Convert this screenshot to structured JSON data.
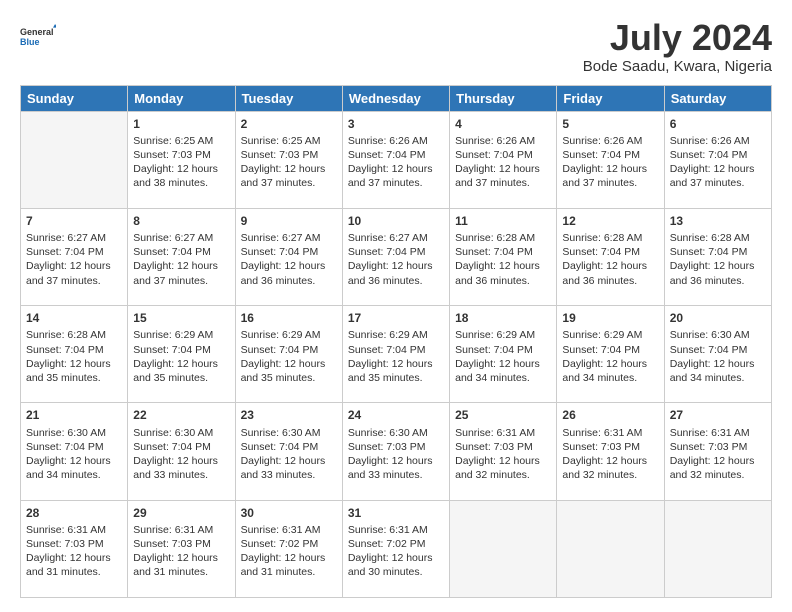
{
  "logo": {
    "line1": "General",
    "line2": "Blue"
  },
  "title": "July 2024",
  "subtitle": "Bode Saadu, Kwara, Nigeria",
  "days_of_week": [
    "Sunday",
    "Monday",
    "Tuesday",
    "Wednesday",
    "Thursday",
    "Friday",
    "Saturday"
  ],
  "weeks": [
    [
      {
        "day": "",
        "sunrise": "",
        "sunset": "",
        "daylight": ""
      },
      {
        "day": "1",
        "sunrise": "Sunrise: 6:25 AM",
        "sunset": "Sunset: 7:03 PM",
        "daylight": "Daylight: 12 hours and 38 minutes."
      },
      {
        "day": "2",
        "sunrise": "Sunrise: 6:25 AM",
        "sunset": "Sunset: 7:03 PM",
        "daylight": "Daylight: 12 hours and 37 minutes."
      },
      {
        "day": "3",
        "sunrise": "Sunrise: 6:26 AM",
        "sunset": "Sunset: 7:04 PM",
        "daylight": "Daylight: 12 hours and 37 minutes."
      },
      {
        "day": "4",
        "sunrise": "Sunrise: 6:26 AM",
        "sunset": "Sunset: 7:04 PM",
        "daylight": "Daylight: 12 hours and 37 minutes."
      },
      {
        "day": "5",
        "sunrise": "Sunrise: 6:26 AM",
        "sunset": "Sunset: 7:04 PM",
        "daylight": "Daylight: 12 hours and 37 minutes."
      },
      {
        "day": "6",
        "sunrise": "Sunrise: 6:26 AM",
        "sunset": "Sunset: 7:04 PM",
        "daylight": "Daylight: 12 hours and 37 minutes."
      }
    ],
    [
      {
        "day": "7",
        "sunrise": "Sunrise: 6:27 AM",
        "sunset": "Sunset: 7:04 PM",
        "daylight": "Daylight: 12 hours and 37 minutes."
      },
      {
        "day": "8",
        "sunrise": "Sunrise: 6:27 AM",
        "sunset": "Sunset: 7:04 PM",
        "daylight": "Daylight: 12 hours and 37 minutes."
      },
      {
        "day": "9",
        "sunrise": "Sunrise: 6:27 AM",
        "sunset": "Sunset: 7:04 PM",
        "daylight": "Daylight: 12 hours and 36 minutes."
      },
      {
        "day": "10",
        "sunrise": "Sunrise: 6:27 AM",
        "sunset": "Sunset: 7:04 PM",
        "daylight": "Daylight: 12 hours and 36 minutes."
      },
      {
        "day": "11",
        "sunrise": "Sunrise: 6:28 AM",
        "sunset": "Sunset: 7:04 PM",
        "daylight": "Daylight: 12 hours and 36 minutes."
      },
      {
        "day": "12",
        "sunrise": "Sunrise: 6:28 AM",
        "sunset": "Sunset: 7:04 PM",
        "daylight": "Daylight: 12 hours and 36 minutes."
      },
      {
        "day": "13",
        "sunrise": "Sunrise: 6:28 AM",
        "sunset": "Sunset: 7:04 PM",
        "daylight": "Daylight: 12 hours and 36 minutes."
      }
    ],
    [
      {
        "day": "14",
        "sunrise": "Sunrise: 6:28 AM",
        "sunset": "Sunset: 7:04 PM",
        "daylight": "Daylight: 12 hours and 35 minutes."
      },
      {
        "day": "15",
        "sunrise": "Sunrise: 6:29 AM",
        "sunset": "Sunset: 7:04 PM",
        "daylight": "Daylight: 12 hours and 35 minutes."
      },
      {
        "day": "16",
        "sunrise": "Sunrise: 6:29 AM",
        "sunset": "Sunset: 7:04 PM",
        "daylight": "Daylight: 12 hours and 35 minutes."
      },
      {
        "day": "17",
        "sunrise": "Sunrise: 6:29 AM",
        "sunset": "Sunset: 7:04 PM",
        "daylight": "Daylight: 12 hours and 35 minutes."
      },
      {
        "day": "18",
        "sunrise": "Sunrise: 6:29 AM",
        "sunset": "Sunset: 7:04 PM",
        "daylight": "Daylight: 12 hours and 34 minutes."
      },
      {
        "day": "19",
        "sunrise": "Sunrise: 6:29 AM",
        "sunset": "Sunset: 7:04 PM",
        "daylight": "Daylight: 12 hours and 34 minutes."
      },
      {
        "day": "20",
        "sunrise": "Sunrise: 6:30 AM",
        "sunset": "Sunset: 7:04 PM",
        "daylight": "Daylight: 12 hours and 34 minutes."
      }
    ],
    [
      {
        "day": "21",
        "sunrise": "Sunrise: 6:30 AM",
        "sunset": "Sunset: 7:04 PM",
        "daylight": "Daylight: 12 hours and 34 minutes."
      },
      {
        "day": "22",
        "sunrise": "Sunrise: 6:30 AM",
        "sunset": "Sunset: 7:04 PM",
        "daylight": "Daylight: 12 hours and 33 minutes."
      },
      {
        "day": "23",
        "sunrise": "Sunrise: 6:30 AM",
        "sunset": "Sunset: 7:04 PM",
        "daylight": "Daylight: 12 hours and 33 minutes."
      },
      {
        "day": "24",
        "sunrise": "Sunrise: 6:30 AM",
        "sunset": "Sunset: 7:03 PM",
        "daylight": "Daylight: 12 hours and 33 minutes."
      },
      {
        "day": "25",
        "sunrise": "Sunrise: 6:31 AM",
        "sunset": "Sunset: 7:03 PM",
        "daylight": "Daylight: 12 hours and 32 minutes."
      },
      {
        "day": "26",
        "sunrise": "Sunrise: 6:31 AM",
        "sunset": "Sunset: 7:03 PM",
        "daylight": "Daylight: 12 hours and 32 minutes."
      },
      {
        "day": "27",
        "sunrise": "Sunrise: 6:31 AM",
        "sunset": "Sunset: 7:03 PM",
        "daylight": "Daylight: 12 hours and 32 minutes."
      }
    ],
    [
      {
        "day": "28",
        "sunrise": "Sunrise: 6:31 AM",
        "sunset": "Sunset: 7:03 PM",
        "daylight": "Daylight: 12 hours and 31 minutes."
      },
      {
        "day": "29",
        "sunrise": "Sunrise: 6:31 AM",
        "sunset": "Sunset: 7:03 PM",
        "daylight": "Daylight: 12 hours and 31 minutes."
      },
      {
        "day": "30",
        "sunrise": "Sunrise: 6:31 AM",
        "sunset": "Sunset: 7:02 PM",
        "daylight": "Daylight: 12 hours and 31 minutes."
      },
      {
        "day": "31",
        "sunrise": "Sunrise: 6:31 AM",
        "sunset": "Sunset: 7:02 PM",
        "daylight": "Daylight: 12 hours and 30 minutes."
      },
      {
        "day": "",
        "sunrise": "",
        "sunset": "",
        "daylight": ""
      },
      {
        "day": "",
        "sunrise": "",
        "sunset": "",
        "daylight": ""
      },
      {
        "day": "",
        "sunrise": "",
        "sunset": "",
        "daylight": ""
      }
    ]
  ]
}
